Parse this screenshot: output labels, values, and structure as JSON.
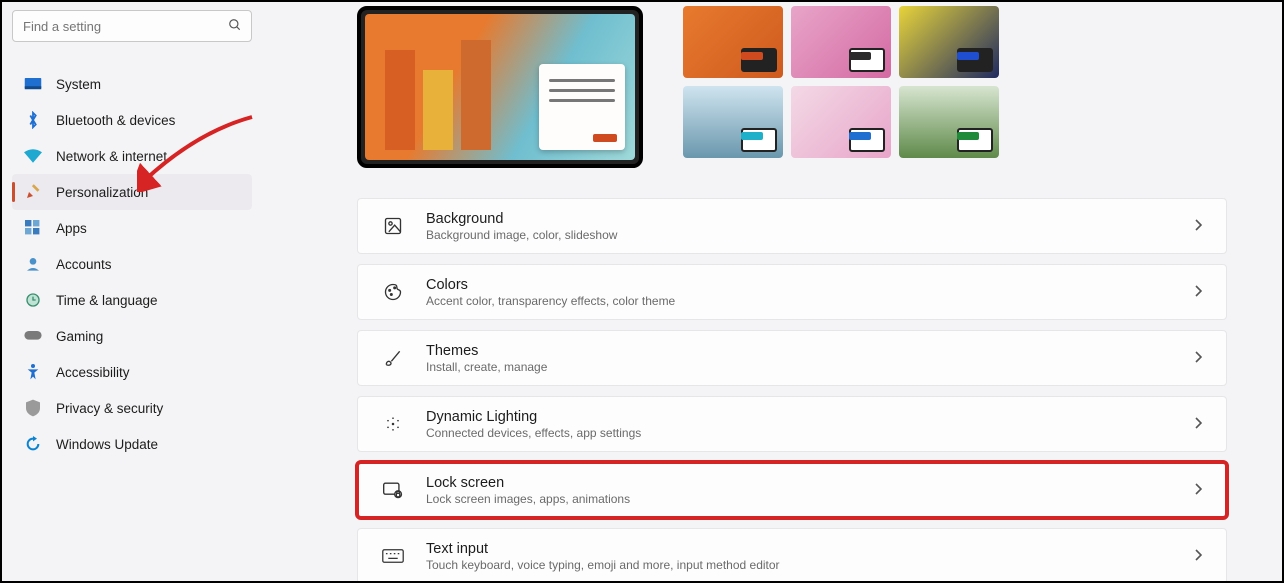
{
  "search": {
    "placeholder": "Find a setting"
  },
  "sidebar": {
    "items": [
      {
        "label": "System",
        "color": "#1f6fd0"
      },
      {
        "label": "Bluetooth & devices",
        "color": "#1f6fd0"
      },
      {
        "label": "Network & internet",
        "color": "#1fa9d0"
      },
      {
        "label": "Personalization",
        "color": "#c94f2f",
        "selected": true
      },
      {
        "label": "Apps",
        "color": "#3a7bbd"
      },
      {
        "label": "Accounts",
        "color": "#4a91c9"
      },
      {
        "label": "Time & language",
        "color": "#3a8f6f"
      },
      {
        "label": "Gaming",
        "color": "#7a7a7a"
      },
      {
        "label": "Accessibility",
        "color": "#1f6fd0"
      },
      {
        "label": "Privacy & security",
        "color": "#7a7a7a"
      },
      {
        "label": "Windows Update",
        "color": "#0a84d0"
      }
    ]
  },
  "themes": [
    {
      "bg": "linear-gradient(135deg,#e77a2e,#cf5a1e)",
      "pip": "dark",
      "sw": "#cf4a1e"
    },
    {
      "bg": "linear-gradient(135deg,#e8a5c9,#d46aa3)",
      "pip": "light",
      "sw": "#2b2b2b"
    },
    {
      "bg": "linear-gradient(135deg,#e8d43a,#1f2a60)",
      "pip": "dark",
      "sw": "#1f4fd0"
    },
    {
      "bg": "linear-gradient(180deg,#cfe4ef,#6a97ad)",
      "pip": "light",
      "sw": "#1fb0c9"
    },
    {
      "bg": "linear-gradient(135deg,#f3d9e6,#e8a5c9)",
      "pip": "light",
      "sw": "#1f6fd0"
    },
    {
      "bg": "linear-gradient(180deg,#d7e5d0,#5f8a4a)",
      "pip": "light",
      "sw": "#1f8a3a"
    }
  ],
  "cards": [
    {
      "icon": "image",
      "title": "Background",
      "sub": "Background image, color, slideshow"
    },
    {
      "icon": "palette",
      "title": "Colors",
      "sub": "Accent color, transparency effects, color theme"
    },
    {
      "icon": "brush",
      "title": "Themes",
      "sub": "Install, create, manage"
    },
    {
      "icon": "sparkle",
      "title": "Dynamic Lighting",
      "sub": "Connected devices, effects, app settings"
    },
    {
      "icon": "lock",
      "title": "Lock screen",
      "sub": "Lock screen images, apps, animations",
      "highlight": true
    },
    {
      "icon": "keyboard",
      "title": "Text input",
      "sub": "Touch keyboard, voice typing, emoji and more, input method editor"
    }
  ]
}
